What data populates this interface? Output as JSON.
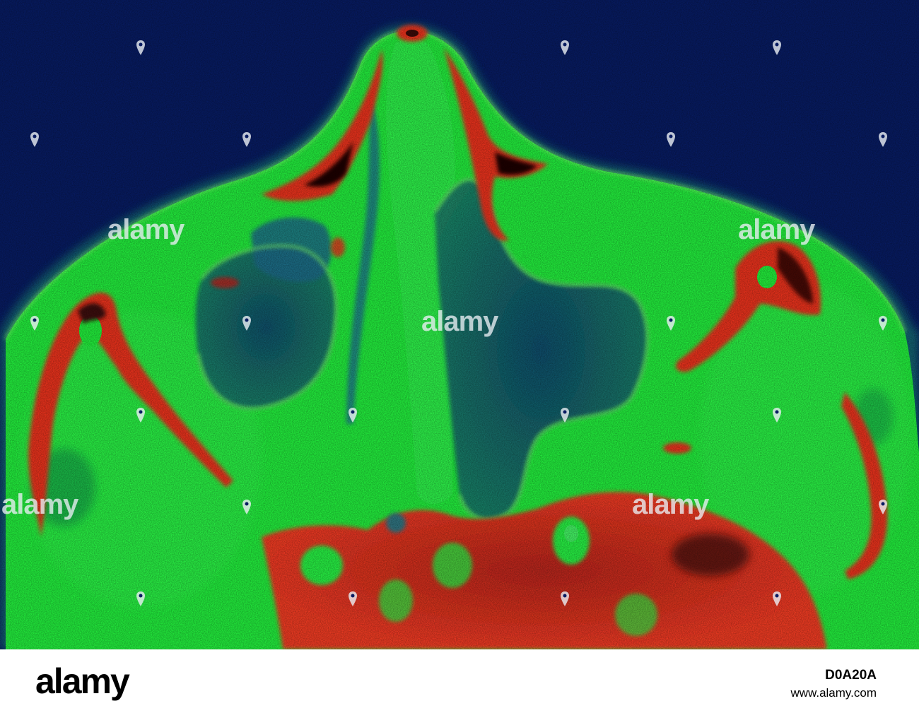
{
  "image": {
    "subject": "false-color axial scan of nasal cavity and sinuses",
    "colors": {
      "background": "#071b61",
      "soft_tissue": "#1ff03a",
      "bone": "#e8321f",
      "air_cavity": "#0d4d6c",
      "dark_core": "#0a0a0a"
    }
  },
  "watermark": {
    "text": "alamy",
    "icon": "pin-marker-icon"
  },
  "footer": {
    "logo": "alamy",
    "image_id": "D0A20A",
    "site": "www.alamy.com"
  }
}
